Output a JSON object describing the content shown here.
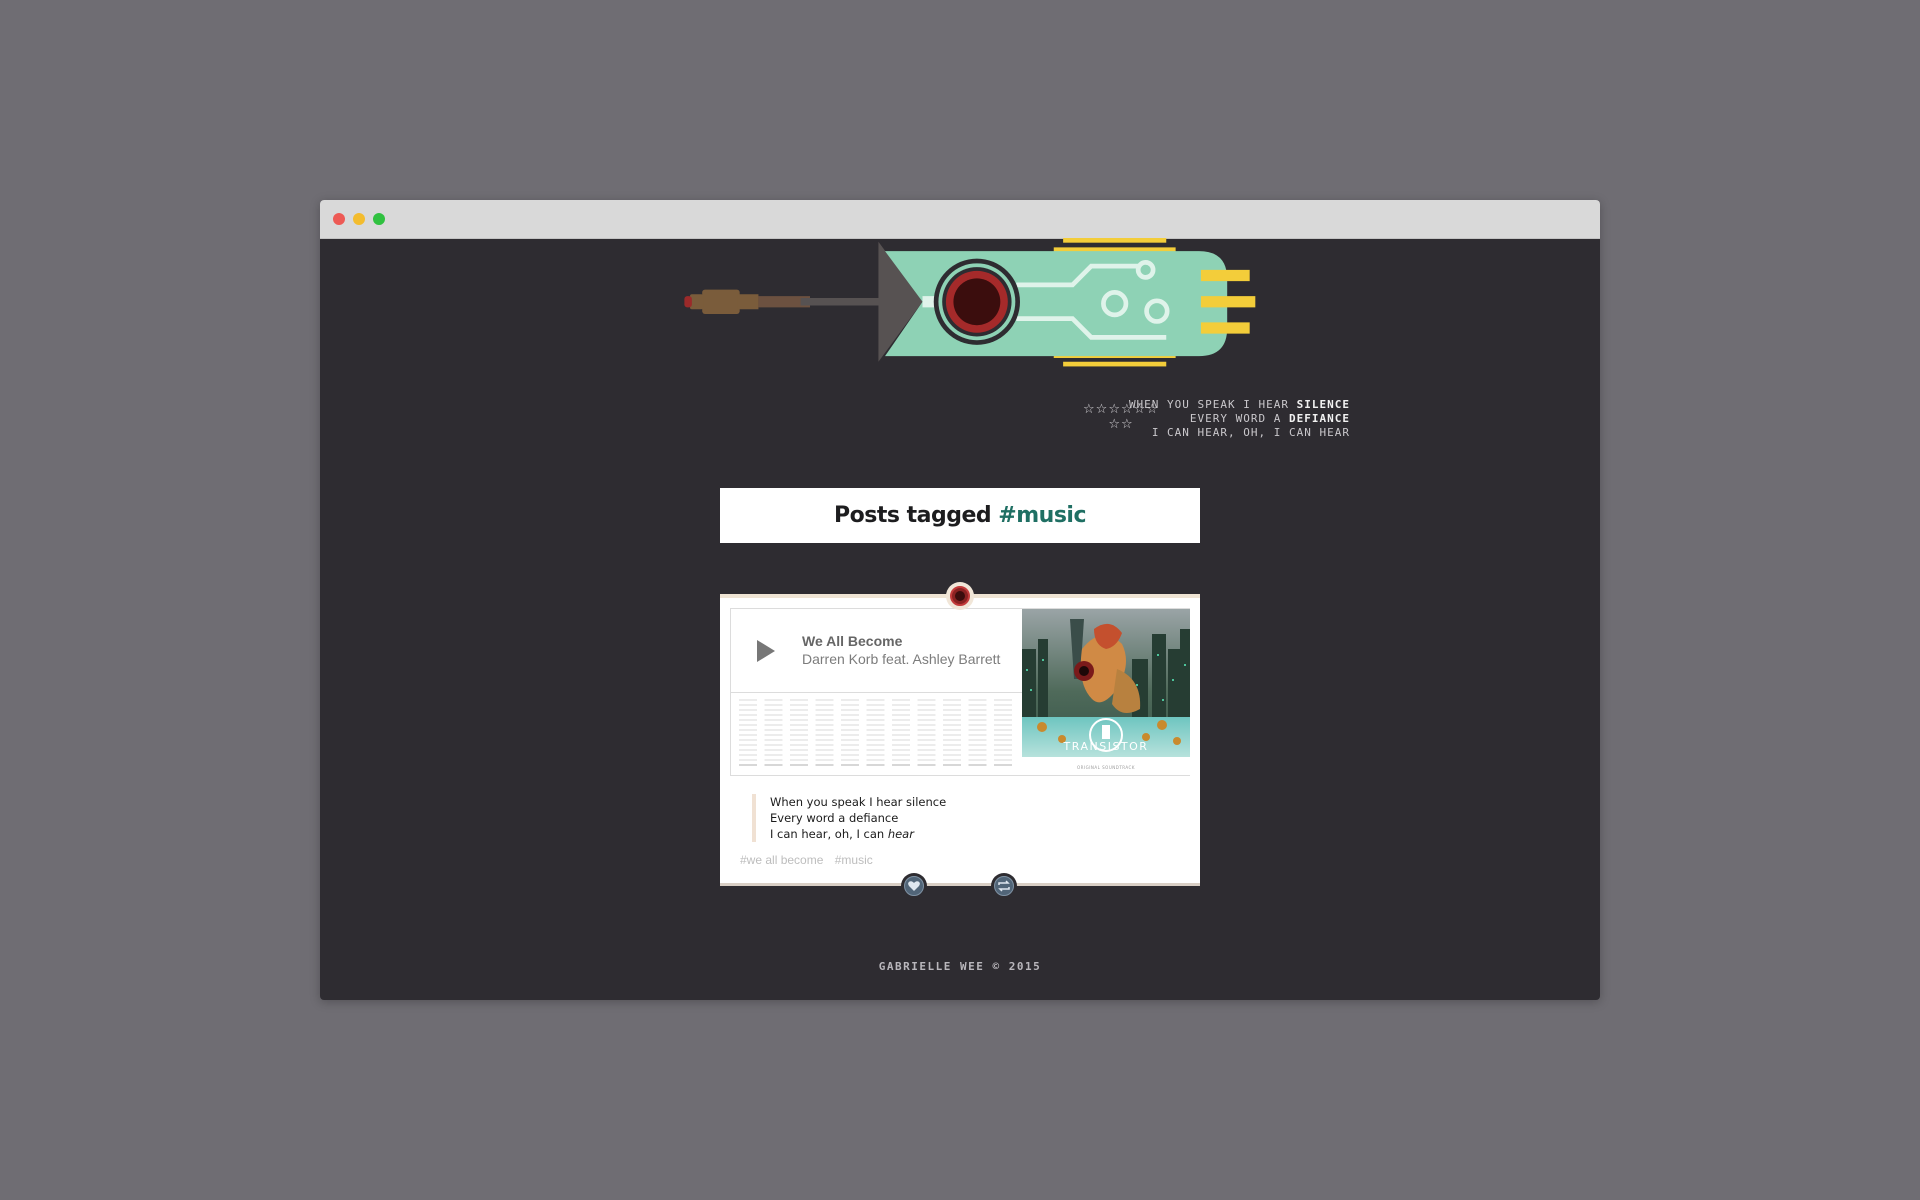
{
  "window": {
    "controls": {
      "close_color": "#ed5a55",
      "minimize_color": "#f3bc2e",
      "maximize_color": "#30c140"
    }
  },
  "header": {
    "lyrics_lines": [
      {
        "prefix": "WHEN YOU SPEAK I HEAR ",
        "bold": "SILENCE"
      },
      {
        "prefix": "EVERY WORD A ",
        "bold": "DEFIANCE"
      },
      {
        "prefix": "I CAN HEAR, OH, I CAN HEAR",
        "bold": ""
      }
    ],
    "stars_row1": "☆☆☆☆☆☆",
    "stars_row2": "☆☆"
  },
  "tag_heading": {
    "prefix": "Posts tagged ",
    "tag": "#music"
  },
  "post": {
    "track": {
      "title": "We All Become",
      "artist": "Darren Korb feat. Ashley Barrett"
    },
    "album_art": {
      "logo_text": "TRANSISTOR",
      "subtitle": "ORIGINAL SOUNDTRACK"
    },
    "quote": {
      "line1": "When you speak I hear silence",
      "line2": "Every word a defiance",
      "line3_prefix": "I can hear, oh, I can ",
      "line3_em": "hear"
    },
    "tags": [
      "#we all become",
      "#music"
    ]
  },
  "actions": {
    "like_icon": "heart-icon",
    "reblog_icon": "reblog-icon"
  },
  "footer": {
    "text": "GABRIELLE WEE © 2015"
  },
  "colors": {
    "page_background": "#6f6d73",
    "window_background": "#2e2c31",
    "accent_teal": "#1f6f63",
    "sword_teal": "#8ed2b5",
    "sword_yellow": "#f3cd3a",
    "sword_red": "#9e2727"
  }
}
